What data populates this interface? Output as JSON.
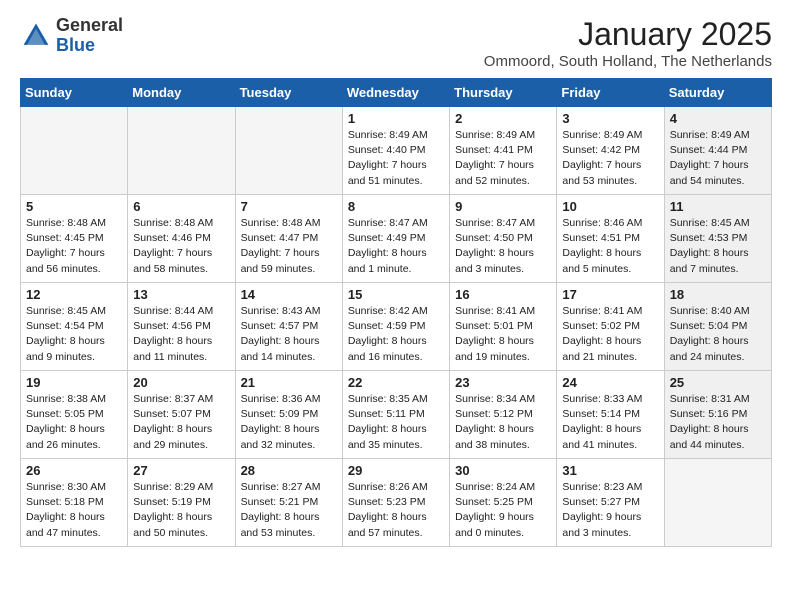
{
  "logo": {
    "general": "General",
    "blue": "Blue"
  },
  "title": "January 2025",
  "subtitle": "Ommoord, South Holland, The Netherlands",
  "days_header": [
    "Sunday",
    "Monday",
    "Tuesday",
    "Wednesday",
    "Thursday",
    "Friday",
    "Saturday"
  ],
  "weeks": [
    [
      {
        "num": "",
        "info": "",
        "empty": true
      },
      {
        "num": "",
        "info": "",
        "empty": true
      },
      {
        "num": "",
        "info": "",
        "empty": true
      },
      {
        "num": "1",
        "info": "Sunrise: 8:49 AM\nSunset: 4:40 PM\nDaylight: 7 hours\nand 51 minutes."
      },
      {
        "num": "2",
        "info": "Sunrise: 8:49 AM\nSunset: 4:41 PM\nDaylight: 7 hours\nand 52 minutes."
      },
      {
        "num": "3",
        "info": "Sunrise: 8:49 AM\nSunset: 4:42 PM\nDaylight: 7 hours\nand 53 minutes."
      },
      {
        "num": "4",
        "info": "Sunrise: 8:49 AM\nSunset: 4:44 PM\nDaylight: 7 hours\nand 54 minutes.",
        "shaded": true
      }
    ],
    [
      {
        "num": "5",
        "info": "Sunrise: 8:48 AM\nSunset: 4:45 PM\nDaylight: 7 hours\nand 56 minutes."
      },
      {
        "num": "6",
        "info": "Sunrise: 8:48 AM\nSunset: 4:46 PM\nDaylight: 7 hours\nand 58 minutes."
      },
      {
        "num": "7",
        "info": "Sunrise: 8:48 AM\nSunset: 4:47 PM\nDaylight: 7 hours\nand 59 minutes."
      },
      {
        "num": "8",
        "info": "Sunrise: 8:47 AM\nSunset: 4:49 PM\nDaylight: 8 hours\nand 1 minute."
      },
      {
        "num": "9",
        "info": "Sunrise: 8:47 AM\nSunset: 4:50 PM\nDaylight: 8 hours\nand 3 minutes."
      },
      {
        "num": "10",
        "info": "Sunrise: 8:46 AM\nSunset: 4:51 PM\nDaylight: 8 hours\nand 5 minutes."
      },
      {
        "num": "11",
        "info": "Sunrise: 8:45 AM\nSunset: 4:53 PM\nDaylight: 8 hours\nand 7 minutes.",
        "shaded": true
      }
    ],
    [
      {
        "num": "12",
        "info": "Sunrise: 8:45 AM\nSunset: 4:54 PM\nDaylight: 8 hours\nand 9 minutes."
      },
      {
        "num": "13",
        "info": "Sunrise: 8:44 AM\nSunset: 4:56 PM\nDaylight: 8 hours\nand 11 minutes."
      },
      {
        "num": "14",
        "info": "Sunrise: 8:43 AM\nSunset: 4:57 PM\nDaylight: 8 hours\nand 14 minutes."
      },
      {
        "num": "15",
        "info": "Sunrise: 8:42 AM\nSunset: 4:59 PM\nDaylight: 8 hours\nand 16 minutes."
      },
      {
        "num": "16",
        "info": "Sunrise: 8:41 AM\nSunset: 5:01 PM\nDaylight: 8 hours\nand 19 minutes."
      },
      {
        "num": "17",
        "info": "Sunrise: 8:41 AM\nSunset: 5:02 PM\nDaylight: 8 hours\nand 21 minutes."
      },
      {
        "num": "18",
        "info": "Sunrise: 8:40 AM\nSunset: 5:04 PM\nDaylight: 8 hours\nand 24 minutes.",
        "shaded": true
      }
    ],
    [
      {
        "num": "19",
        "info": "Sunrise: 8:38 AM\nSunset: 5:05 PM\nDaylight: 8 hours\nand 26 minutes."
      },
      {
        "num": "20",
        "info": "Sunrise: 8:37 AM\nSunset: 5:07 PM\nDaylight: 8 hours\nand 29 minutes."
      },
      {
        "num": "21",
        "info": "Sunrise: 8:36 AM\nSunset: 5:09 PM\nDaylight: 8 hours\nand 32 minutes."
      },
      {
        "num": "22",
        "info": "Sunrise: 8:35 AM\nSunset: 5:11 PM\nDaylight: 8 hours\nand 35 minutes."
      },
      {
        "num": "23",
        "info": "Sunrise: 8:34 AM\nSunset: 5:12 PM\nDaylight: 8 hours\nand 38 minutes."
      },
      {
        "num": "24",
        "info": "Sunrise: 8:33 AM\nSunset: 5:14 PM\nDaylight: 8 hours\nand 41 minutes."
      },
      {
        "num": "25",
        "info": "Sunrise: 8:31 AM\nSunset: 5:16 PM\nDaylight: 8 hours\nand 44 minutes.",
        "shaded": true
      }
    ],
    [
      {
        "num": "26",
        "info": "Sunrise: 8:30 AM\nSunset: 5:18 PM\nDaylight: 8 hours\nand 47 minutes."
      },
      {
        "num": "27",
        "info": "Sunrise: 8:29 AM\nSunset: 5:19 PM\nDaylight: 8 hours\nand 50 minutes."
      },
      {
        "num": "28",
        "info": "Sunrise: 8:27 AM\nSunset: 5:21 PM\nDaylight: 8 hours\nand 53 minutes."
      },
      {
        "num": "29",
        "info": "Sunrise: 8:26 AM\nSunset: 5:23 PM\nDaylight: 8 hours\nand 57 minutes."
      },
      {
        "num": "30",
        "info": "Sunrise: 8:24 AM\nSunset: 5:25 PM\nDaylight: 9 hours\nand 0 minutes."
      },
      {
        "num": "31",
        "info": "Sunrise: 8:23 AM\nSunset: 5:27 PM\nDaylight: 9 hours\nand 3 minutes."
      },
      {
        "num": "",
        "info": "",
        "empty": true,
        "shaded": true
      }
    ]
  ]
}
